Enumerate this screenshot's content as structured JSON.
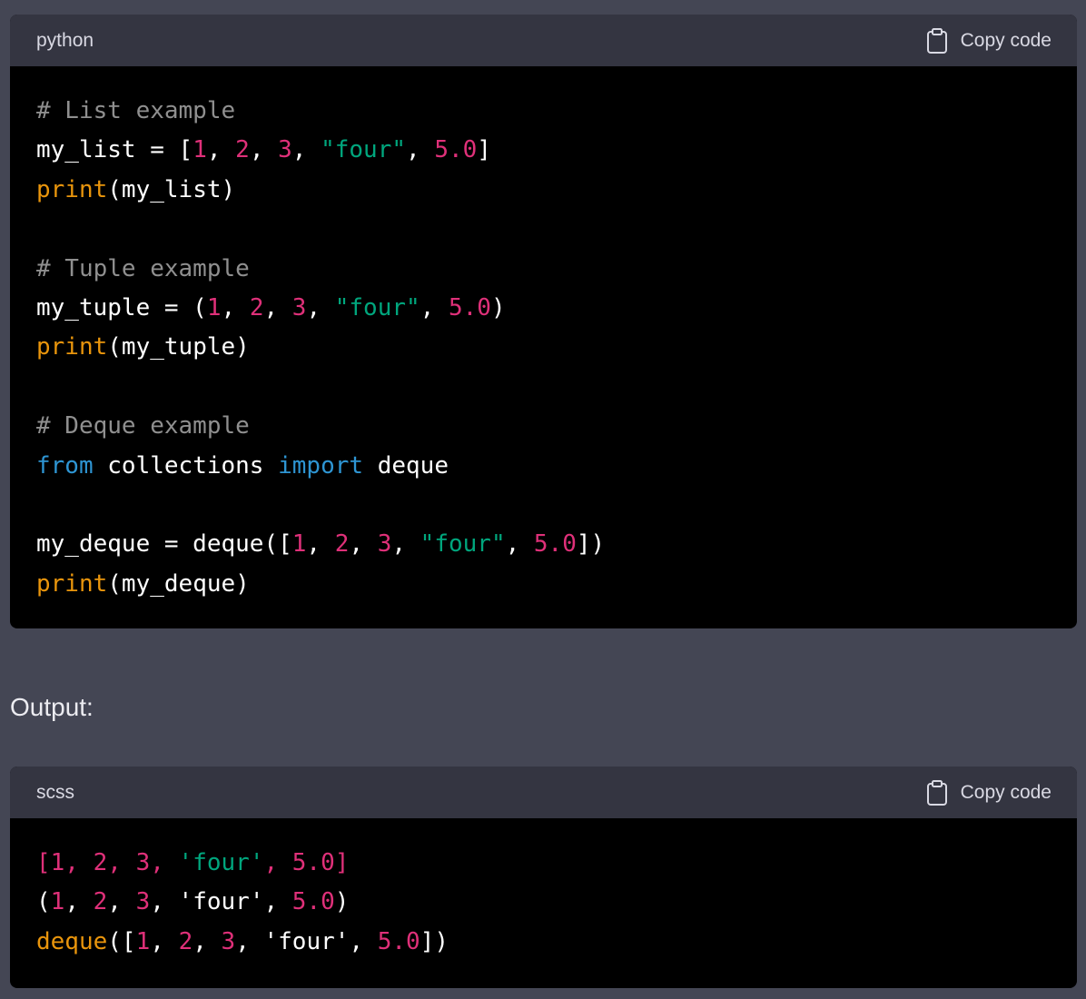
{
  "colors": {
    "page_background": "#444654",
    "header_background": "#343541",
    "code_background": "#000000",
    "comment": "#8f8f8f",
    "number": "#df3079",
    "string": "#00a67d",
    "builtin": "#e9950c",
    "keyword": "#2e95d3",
    "plain": "#ffffff"
  },
  "blocks": [
    {
      "language": "python",
      "copy_label": "Copy code",
      "copy_icon": "clipboard-icon",
      "lines": [
        [
          {
            "t": "comment",
            "v": "# List example"
          }
        ],
        [
          {
            "t": "plain",
            "v": "my_list = ["
          },
          {
            "t": "number",
            "v": "1"
          },
          {
            "t": "plain",
            "v": ", "
          },
          {
            "t": "number",
            "v": "2"
          },
          {
            "t": "plain",
            "v": ", "
          },
          {
            "t": "number",
            "v": "3"
          },
          {
            "t": "plain",
            "v": ", "
          },
          {
            "t": "string",
            "v": "\"four\""
          },
          {
            "t": "plain",
            "v": ", "
          },
          {
            "t": "number",
            "v": "5.0"
          },
          {
            "t": "plain",
            "v": "]"
          }
        ],
        [
          {
            "t": "builtin",
            "v": "print"
          },
          {
            "t": "plain",
            "v": "(my_list)"
          }
        ],
        [],
        [
          {
            "t": "comment",
            "v": "# Tuple example"
          }
        ],
        [
          {
            "t": "plain",
            "v": "my_tuple = ("
          },
          {
            "t": "number",
            "v": "1"
          },
          {
            "t": "plain",
            "v": ", "
          },
          {
            "t": "number",
            "v": "2"
          },
          {
            "t": "plain",
            "v": ", "
          },
          {
            "t": "number",
            "v": "3"
          },
          {
            "t": "plain",
            "v": ", "
          },
          {
            "t": "string",
            "v": "\"four\""
          },
          {
            "t": "plain",
            "v": ", "
          },
          {
            "t": "number",
            "v": "5.0"
          },
          {
            "t": "plain",
            "v": ")"
          }
        ],
        [
          {
            "t": "builtin",
            "v": "print"
          },
          {
            "t": "plain",
            "v": "(my_tuple)"
          }
        ],
        [],
        [
          {
            "t": "comment",
            "v": "# Deque example"
          }
        ],
        [
          {
            "t": "keyword",
            "v": "from"
          },
          {
            "t": "plain",
            "v": " collections "
          },
          {
            "t": "keyword",
            "v": "import"
          },
          {
            "t": "plain",
            "v": " deque"
          }
        ],
        [],
        [
          {
            "t": "plain",
            "v": "my_deque = deque(["
          },
          {
            "t": "number",
            "v": "1"
          },
          {
            "t": "plain",
            "v": ", "
          },
          {
            "t": "number",
            "v": "2"
          },
          {
            "t": "plain",
            "v": ", "
          },
          {
            "t": "number",
            "v": "3"
          },
          {
            "t": "plain",
            "v": ", "
          },
          {
            "t": "string",
            "v": "\"four\""
          },
          {
            "t": "plain",
            "v": ", "
          },
          {
            "t": "number",
            "v": "5.0"
          },
          {
            "t": "plain",
            "v": "])"
          }
        ],
        [
          {
            "t": "builtin",
            "v": "print"
          },
          {
            "t": "plain",
            "v": "(my_deque)"
          }
        ]
      ]
    },
    {
      "language": "scss",
      "copy_label": "Copy code",
      "copy_icon": "clipboard-icon",
      "lines": [
        [
          {
            "t": "number",
            "v": "[1, 2, 3, "
          },
          {
            "t": "string",
            "v": "'four'"
          },
          {
            "t": "number",
            "v": ", 5.0]"
          }
        ],
        [
          {
            "t": "plain",
            "v": "("
          },
          {
            "t": "number",
            "v": "1"
          },
          {
            "t": "plain",
            "v": ", "
          },
          {
            "t": "number",
            "v": "2"
          },
          {
            "t": "plain",
            "v": ", "
          },
          {
            "t": "number",
            "v": "3"
          },
          {
            "t": "plain",
            "v": ", 'four', "
          },
          {
            "t": "number",
            "v": "5.0"
          },
          {
            "t": "plain",
            "v": ")"
          }
        ],
        [
          {
            "t": "builtin",
            "v": "deque"
          },
          {
            "t": "plain",
            "v": "(["
          },
          {
            "t": "number",
            "v": "1"
          },
          {
            "t": "plain",
            "v": ", "
          },
          {
            "t": "number",
            "v": "2"
          },
          {
            "t": "plain",
            "v": ", "
          },
          {
            "t": "number",
            "v": "3"
          },
          {
            "t": "plain",
            "v": ", 'four', "
          },
          {
            "t": "number",
            "v": "5.0"
          },
          {
            "t": "plain",
            "v": "])"
          }
        ]
      ]
    }
  ],
  "output_label": "Output:"
}
